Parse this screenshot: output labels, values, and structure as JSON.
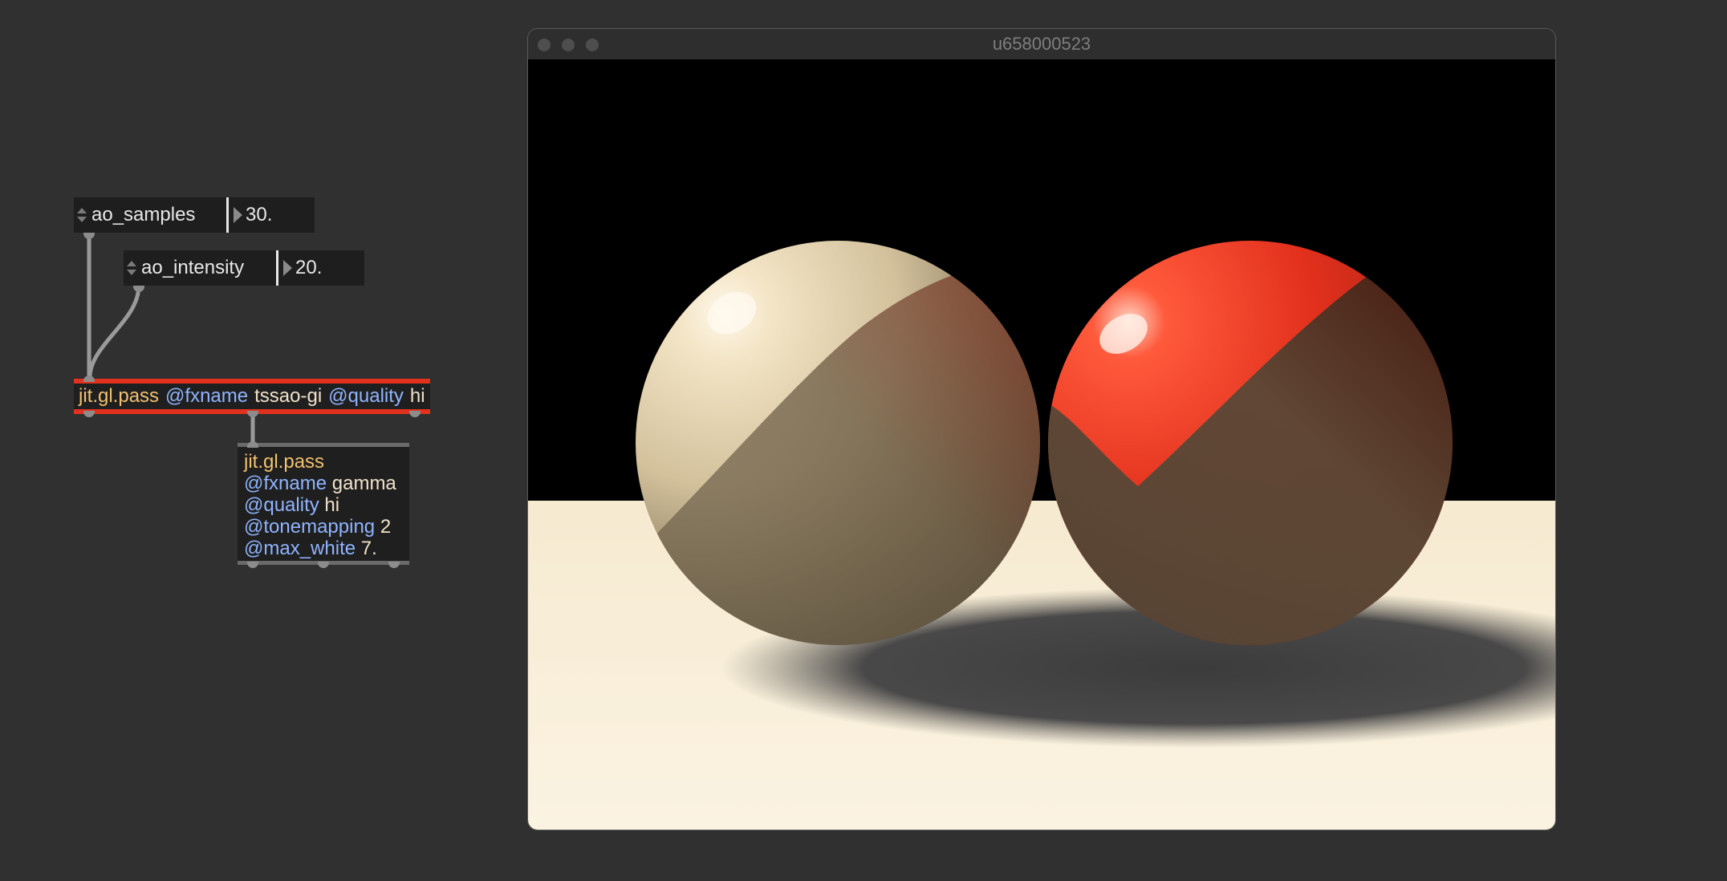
{
  "patcher": {
    "params": [
      {
        "name": "ao_samples",
        "value": "30."
      },
      {
        "name": "ao_intensity",
        "value": "20."
      }
    ],
    "pass1": {
      "obj": "jit.gl.pass",
      "attr1": "@fxname",
      "val1": "tssao-gi",
      "attr2": "@quality",
      "val2": "hi"
    },
    "pass2": {
      "obj": "jit.gl.pass",
      "attr1": "@fxname",
      "val1": "gamma",
      "attr2": "@quality",
      "val2": "hi",
      "attr3": "@tonemapping",
      "val3": "2",
      "attr4": "@max_white",
      "val4": "7."
    }
  },
  "window": {
    "title": "u658000523"
  },
  "scene": {
    "sphere_left_color": "#d8c9a6",
    "sphere_right_color": "#e8321f",
    "floor_color": "#f6ead0",
    "background_color": "#000000"
  }
}
